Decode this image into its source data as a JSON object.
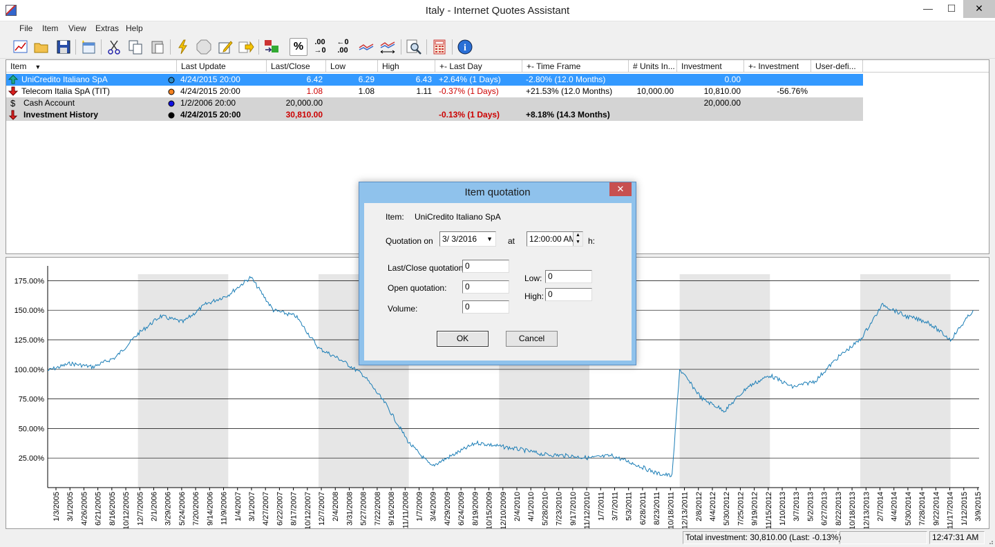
{
  "window": {
    "title": "Italy - Internet Quotes Assistant",
    "min": "—",
    "max": "☐",
    "close": "✕"
  },
  "menu": [
    "File",
    "Item",
    "View",
    "Extras",
    "Help"
  ],
  "toolbar": {
    "icons": [
      "chart-icon",
      "open-folder-icon",
      "save-icon",
      "new-item-icon",
      "cut-icon",
      "copy-icon",
      "paste-icon",
      "update-icon",
      "stop-icon",
      "edit-icon",
      "export-icon",
      "currency-icon",
      "percent-icon",
      "increase-decimals-icon",
      "decrease-decimals-icon",
      "compare-chart-icon",
      "timeframe-chart-icon",
      "search-icon",
      "calculator-icon",
      "info-icon"
    ],
    "labels": {
      "percent": "%",
      "inc_dec": ".00",
      "dec_dec": ".00"
    }
  },
  "grid": {
    "columns": [
      "Item",
      "Last Update",
      "Last/Close",
      "Low",
      "High",
      "+- Last Day",
      "+- Time Frame",
      "# Units In...",
      "Investment",
      "+- Investment",
      "User-defi..."
    ],
    "rows": [
      {
        "item": "UniCredito Italiano SpA",
        "dot": "#2d8cc6",
        "update": "4/24/2015   20:00",
        "close": "6.42",
        "low": "6.29",
        "high": "6.43",
        "lastday": "+2.64% (1 Days)",
        "timeframe": "-2.80% (12.0 Months)",
        "units": "",
        "investment": "0.00",
        "invdelta": "",
        "user": ""
      },
      {
        "item": "Telecom Italia SpA (TIT)",
        "dot": "#f58220",
        "update": "4/24/2015   20:00",
        "close": "1.08",
        "low": "1.08",
        "high": "1.11",
        "lastday": "-0.37% (1 Days)",
        "timeframe": "+21.53% (12.0 Months)",
        "units": "10,000.00",
        "investment": "10,810.00",
        "invdelta": "-56.76%",
        "user": ""
      },
      {
        "item": "Cash Account",
        "dot": "#1010e0",
        "update": "1/2/2006   20:00",
        "close": "20,000.00",
        "low": "",
        "high": "",
        "lastday": "",
        "timeframe": "",
        "units": "",
        "investment": "20,000.00",
        "invdelta": "",
        "user": ""
      },
      {
        "item": "Investment History",
        "dot": "#000000",
        "update": "4/24/2015   20:00",
        "close": "30,810.00",
        "low": "",
        "high": "",
        "lastday": "-0.13% (1 Days)",
        "timeframe": "+8.18% (14.3 Months)",
        "units": "",
        "investment": "",
        "invdelta": "",
        "user": ""
      }
    ]
  },
  "dialog": {
    "title": "Item quotation",
    "item_label": "Item:",
    "item_value": "UniCredito Italiano SpA",
    "quotation_on_label": "Quotation on",
    "date_value": "3/  3/2016",
    "at_label": "at",
    "time_value": "12:00:00 AM",
    "h_label": "h:",
    "last_close_label": "Last/Close quotation:",
    "last_close_value": "0",
    "open_label": "Open quotation:",
    "open_value": "0",
    "volume_label": "Volume:",
    "volume_value": "0",
    "low_label": "Low:",
    "low_value": "0",
    "high_label": "High:",
    "high_value": "0",
    "ok": "OK",
    "cancel": "Cancel"
  },
  "status": {
    "total": "Total investment: 30,810.00 (Last: -0.13%)",
    "time": "12:47:31 AM"
  },
  "chart_data": {
    "type": "line",
    "title": "",
    "xlabel": "",
    "ylabel": "",
    "ylim": [
      0,
      187.5
    ],
    "y_ticks": [
      "25.00%",
      "50.00%",
      "75.00%",
      "100.00%",
      "125.00%",
      "150.00%",
      "175.00%"
    ],
    "x_ticks": [
      "1/3/2005",
      "3/1/2005",
      "4/26/2005",
      "6/21/2005",
      "8/16/2005",
      "10/12/2005",
      "12/7/2005",
      "2/1/2006",
      "3/29/2006",
      "5/24/2006",
      "7/20/2006",
      "9/14/2006",
      "11/9/2006",
      "1/4/2007",
      "3/1/2007",
      "4/27/2007",
      "6/22/2007",
      "8/17/2007",
      "10/12/2007",
      "12/7/2007",
      "2/4/2008",
      "3/31/2008",
      "5/27/2008",
      "7/22/2008",
      "9/16/2008",
      "11/11/2008",
      "1/7/2009",
      "3/4/2009",
      "4/29/2009",
      "6/24/2009",
      "8/19/2009",
      "10/15/2009",
      "12/10/2009",
      "2/4/2010",
      "4/1/2010",
      "5/28/2010",
      "7/23/2010",
      "9/17/2010",
      "11/12/2010",
      "1/7/2011",
      "3/7/2011",
      "5/3/2011",
      "6/28/2011",
      "8/23/2011",
      "10/18/2011",
      "12/13/2011",
      "2/8/2012",
      "4/4/2012",
      "5/30/2012",
      "7/25/2012",
      "9/19/2012",
      "11/15/2012",
      "1/10/2013",
      "3/7/2013",
      "5/2/2013",
      "6/27/2013",
      "8/22/2013",
      "10/18/2013",
      "12/13/2013",
      "2/7/2014",
      "4/4/2014",
      "5/30/2014",
      "7/28/2014",
      "9/22/2014",
      "11/17/2014",
      "1/12/2015",
      "3/9/2015"
    ],
    "shaded_years": [
      2006,
      2008,
      2010,
      2012,
      2014
    ],
    "series": [
      {
        "color": "#1a7db6",
        "x": [
          "2005-01",
          "2005-04",
          "2005-07",
          "2005-10",
          "2006-01",
          "2006-04",
          "2006-07",
          "2006-10",
          "2007-01",
          "2007-04",
          "2007-07",
          "2007-10",
          "2008-01",
          "2008-04",
          "2008-07",
          "2008-10",
          "2009-01",
          "2009-04",
          "2009-07",
          "2009-10",
          "2010-01",
          "2010-04",
          "2010-07",
          "2010-10",
          "2011-01",
          "2011-04",
          "2011-07",
          "2011-10",
          "2011-12",
          "2012-01",
          "2012-04",
          "2012-07",
          "2012-10",
          "2013-01",
          "2013-04",
          "2013-07",
          "2013-10",
          "2014-01",
          "2014-04",
          "2014-07",
          "2014-10",
          "2015-01",
          "2015-04"
        ],
        "values": [
          99,
          105,
          102,
          110,
          130,
          145,
          140,
          155,
          163,
          178,
          150,
          145,
          118,
          108,
          95,
          70,
          38,
          18,
          28,
          38,
          35,
          32,
          28,
          27,
          25,
          27,
          20,
          12,
          10,
          100,
          75,
          65,
          85,
          95,
          85,
          90,
          110,
          125,
          155,
          145,
          140,
          125,
          150
        ]
      }
    ]
  }
}
